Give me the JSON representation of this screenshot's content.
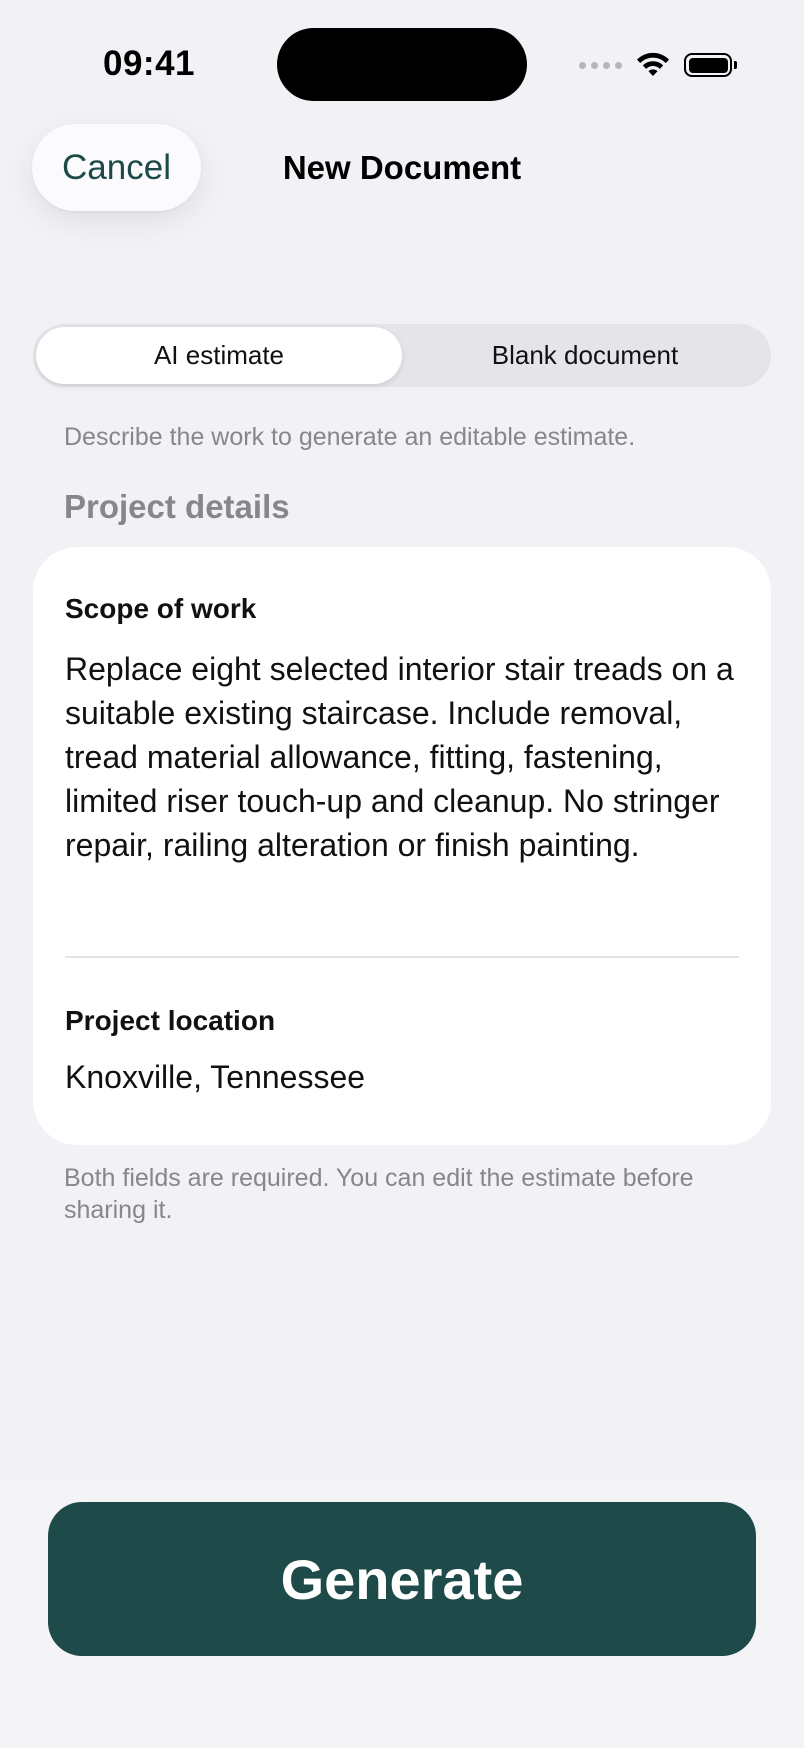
{
  "status_bar": {
    "time": "09:41"
  },
  "nav": {
    "cancel_label": "Cancel",
    "title": "New Document"
  },
  "segmented_control": {
    "options": [
      "AI estimate",
      "Blank document"
    ],
    "selected": "AI estimate"
  },
  "helper_text": "Describe the work to generate an editable estimate.",
  "section_title": "Project details",
  "form": {
    "scope": {
      "label": "Scope of work",
      "value": "Replace eight selected interior stair treads on a suitable existing staircase. Include removal, tread material allowance, fitting, fastening, limited riser touch-up and cleanup. No stringer repair, railing alteration or finish painting."
    },
    "location": {
      "label": "Project location",
      "value": "Knoxville, Tennessee"
    }
  },
  "footnote": "Both fields are required. You can edit the estimate before sharing it.",
  "generate_label": "Generate",
  "colors": {
    "accent": "#1e4a4a",
    "background": "#f1f1f6",
    "secondary_text": "#86868b"
  },
  "icons": [
    "cellular-signal-icon",
    "wifi-icon",
    "battery-icon"
  ]
}
